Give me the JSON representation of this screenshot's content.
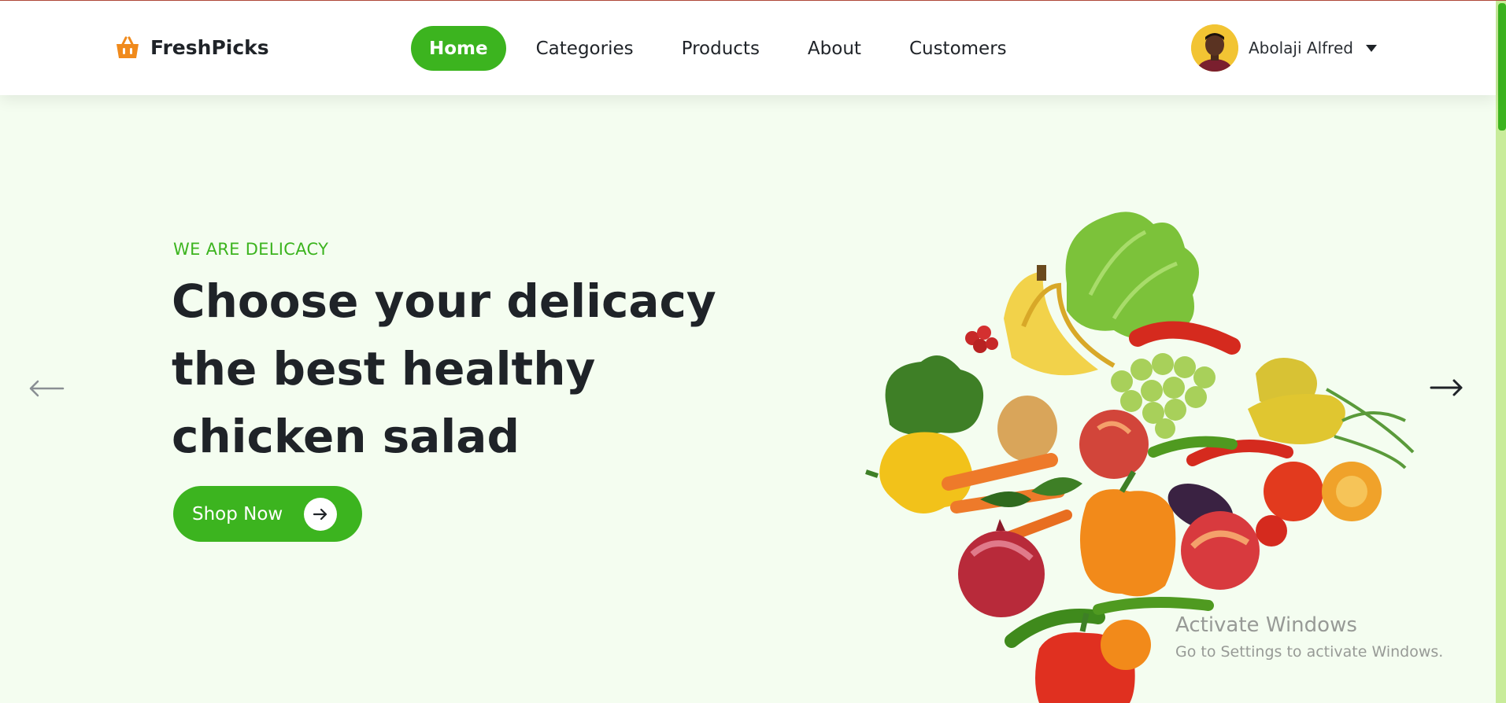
{
  "brand": {
    "name": "FreshPicks",
    "icon": "basket-icon",
    "color": "#f08a1c"
  },
  "nav": {
    "items": [
      {
        "label": "Home",
        "active": true
      },
      {
        "label": "Categories",
        "active": false
      },
      {
        "label": "Products",
        "active": false
      },
      {
        "label": "About",
        "active": false
      },
      {
        "label": "Customers",
        "active": false
      }
    ]
  },
  "user": {
    "name": "Abolaji Alfred",
    "avatar_icon": "avatar",
    "menu_icon": "caret-down-icon"
  },
  "hero": {
    "tagline": "WE ARE DELICACY",
    "headline_lines": [
      "Choose your delicacy",
      "the best healthy",
      "chicken salad"
    ],
    "cta_label": "Shop Now",
    "cta_icon": "arrow-right-icon",
    "prev_icon": "arrow-left-icon",
    "next_icon": "arrow-right-icon"
  },
  "watermark": {
    "line1": "Activate Windows",
    "line2": "Go to Settings to activate Windows."
  },
  "colors": {
    "accent": "#3cb41f",
    "background": "#f4fdf0",
    "text": "#1f2328",
    "header": "#ffffff"
  }
}
